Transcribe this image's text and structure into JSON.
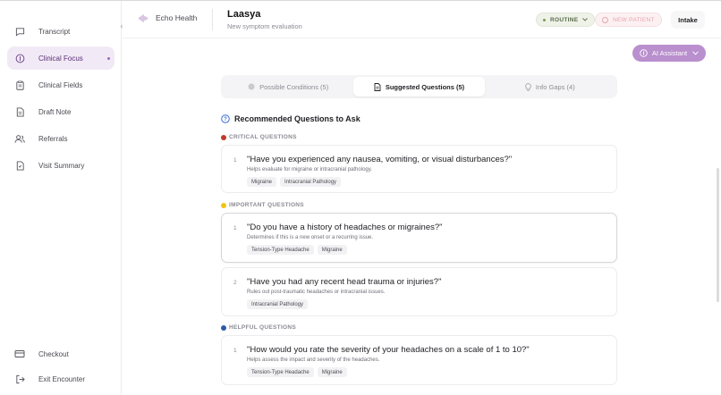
{
  "sidebar": {
    "collapse_icon": "chevron-left-icon",
    "items": [
      {
        "label": "Transcript",
        "icon": "chat-icon"
      },
      {
        "label": "Clinical Focus",
        "icon": "focus-icon"
      },
      {
        "label": "Clinical Fields",
        "icon": "clipboard-icon"
      },
      {
        "label": "Draft Note",
        "icon": "document-icon"
      },
      {
        "label": "Referrals",
        "icon": "users-icon"
      },
      {
        "label": "Visit Summary",
        "icon": "summary-icon"
      }
    ],
    "bottom": [
      {
        "label": "Checkout",
        "icon": "card-icon"
      },
      {
        "label": "Exit Encounter",
        "icon": "exit-icon"
      }
    ]
  },
  "header": {
    "brand": "Echo Health",
    "patient_name": "Laasya",
    "patient_sub": "New symptom evaluation",
    "routine": "ROUTINE",
    "new_patient": "NEW PATIENT",
    "intake": "Intake"
  },
  "ai_assistant": "AI Assistant",
  "tabs": [
    {
      "label": "Possible Conditions (5)"
    },
    {
      "label": "Suggested Questions (5)"
    },
    {
      "label": "Info Gaps (4)"
    }
  ],
  "section_title": "Recommended Questions to Ask",
  "groups": [
    {
      "label": "CRITICAL QUESTIONS",
      "color": "#c0392b"
    },
    {
      "label": "IMPORTANT QUESTIONS",
      "color": "#f1c40f"
    },
    {
      "label": "HELPFUL QUESTIONS",
      "color": "#2e5aa8"
    }
  ],
  "questions": [
    {
      "num": "1",
      "text": "\"Have you experienced any nausea, vomiting, or visual disturbances?\"",
      "desc": "Helps evaluate for migraine or intracranial pathology.",
      "tags": [
        "Migraine",
        "Intracranial Pathology"
      ]
    },
    {
      "num": "1",
      "text": "\"Do you have a history of headaches or migraines?\"",
      "desc": "Determines if this is a new onset or a recurring issue.",
      "tags": [
        "Tension-Type Headache",
        "Migraine"
      ]
    },
    {
      "num": "2",
      "text": "\"Have you had any recent head trauma or injuries?\"",
      "desc": "Rules out post-traumatic headaches or intracranial issues.",
      "tags": [
        "Intracranial Pathology"
      ]
    },
    {
      "num": "1",
      "text": "\"How would you rate the severity of your headaches on a scale of 1 to 10?\"",
      "desc": "Helps assess the impact and severity of the headaches.",
      "tags": [
        "Tension-Type Headache",
        "Migraine"
      ]
    }
  ]
}
